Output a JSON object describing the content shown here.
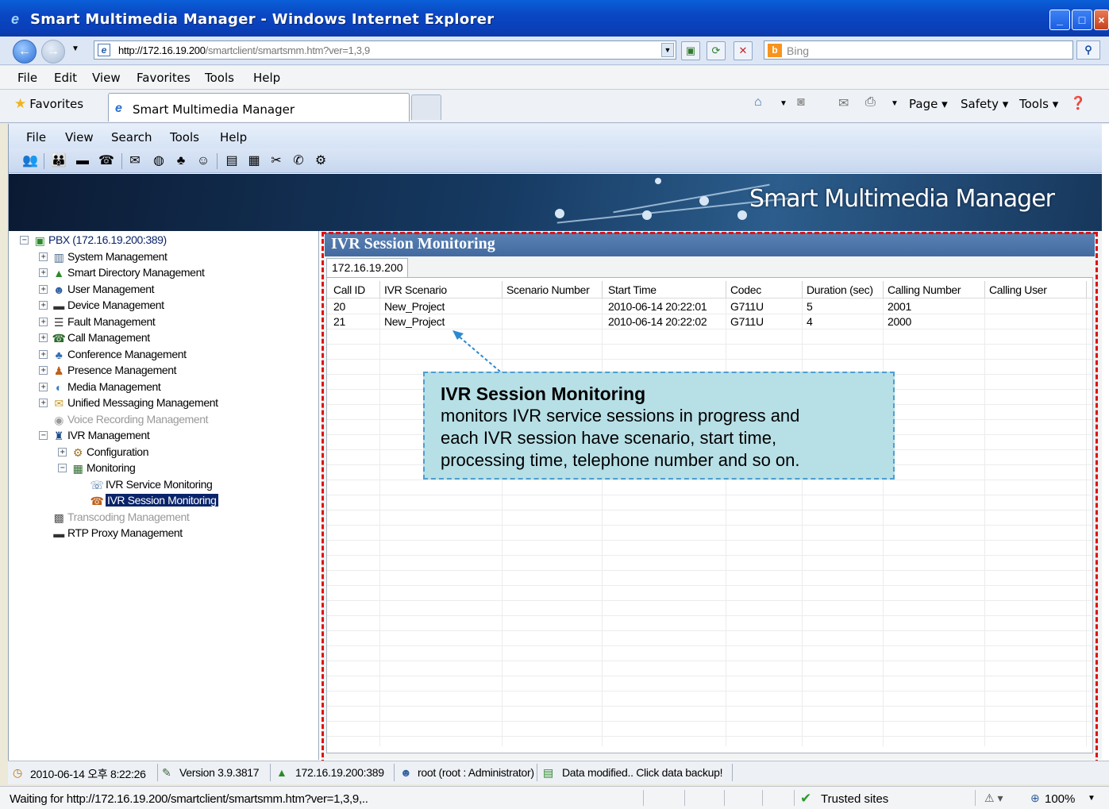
{
  "window": {
    "title": "Smart Multimedia Manager - Windows Internet Explorer"
  },
  "addressbar": {
    "url_host": "http://172.16.19.200",
    "url_path": "/smartclient/smartsmm.htm?ver=1,3,9",
    "search_placeholder": "Bing"
  },
  "ie_menu": [
    "File",
    "Edit",
    "View",
    "Favorites",
    "Tools",
    "Help"
  ],
  "favorites": {
    "label": "Favorites",
    "tab_title": "Smart Multimedia Manager",
    "commands": [
      "Page",
      "Safety",
      "Tools"
    ]
  },
  "app_menu": [
    "File",
    "View",
    "Search",
    "Tools",
    "Help"
  ],
  "banner": {
    "title": "Smart Multimedia Manager"
  },
  "tree": [
    {
      "label": "PBX (172.16.19.200:389)",
      "level": 0,
      "exp": "−",
      "icon": "pbx-icon"
    },
    {
      "label": "System Management",
      "level": 1,
      "exp": "+",
      "icon": "system-icon"
    },
    {
      "label": "Smart Directory Management",
      "level": 1,
      "exp": "+",
      "icon": "directory-icon"
    },
    {
      "label": "User Management",
      "level": 1,
      "exp": "+",
      "icon": "user-icon"
    },
    {
      "label": "Device Management",
      "level": 1,
      "exp": "+",
      "icon": "device-icon"
    },
    {
      "label": "Fault Management",
      "level": 1,
      "exp": "+",
      "icon": "fault-icon"
    },
    {
      "label": "Call Management",
      "level": 1,
      "exp": "+",
      "icon": "call-icon"
    },
    {
      "label": "Conference Management",
      "level": 1,
      "exp": "+",
      "icon": "conference-icon"
    },
    {
      "label": "Presence Management",
      "level": 1,
      "exp": "+",
      "icon": "presence-icon"
    },
    {
      "label": "Media Management",
      "level": 1,
      "exp": "+",
      "icon": "media-icon"
    },
    {
      "label": "Unified Messaging Management",
      "level": 1,
      "exp": "+",
      "icon": "messaging-icon"
    },
    {
      "label": "Voice Recording Management",
      "level": 1,
      "exp": "",
      "icon": "recording-icon",
      "dim": true
    },
    {
      "label": "IVR Management",
      "level": 1,
      "exp": "−",
      "icon": "ivr-icon"
    },
    {
      "label": "Configuration",
      "level": 2,
      "exp": "+",
      "icon": "configuration-icon"
    },
    {
      "label": "Monitoring",
      "level": 2,
      "exp": "−",
      "icon": "monitoring-icon"
    },
    {
      "label": "IVR Service Monitoring",
      "level": 3,
      "exp": "",
      "icon": "service-monitor-icon"
    },
    {
      "label": "IVR Session Monitoring",
      "level": 3,
      "exp": "",
      "icon": "session-monitor-icon",
      "selected": true
    },
    {
      "label": "Transcoding Management",
      "level": 1,
      "exp": "",
      "icon": "transcoding-icon",
      "dim": true
    },
    {
      "label": "RTP Proxy Management",
      "level": 1,
      "exp": "",
      "icon": "rtp-proxy-icon"
    }
  ],
  "panel": {
    "title": "IVR Session Monitoring",
    "server_tab": "172.16.19.200",
    "columns": [
      "Call ID",
      "IVR Scenario",
      "Scenario Number",
      "Start Time",
      "Codec",
      "Duration (sec)",
      "Calling Number",
      "Calling User"
    ],
    "rows": [
      [
        "20",
        "New_Project",
        "",
        "2010-06-14 20:22:01",
        "G711U",
        "5",
        "2001",
        ""
      ],
      [
        "21",
        "New_Project",
        "",
        "2010-06-14 20:22:02",
        "G711U",
        "4",
        "2000",
        ""
      ]
    ]
  },
  "callout": {
    "title": "IVR Session Monitoring",
    "lines": [
      "monitors IVR service sessions in progress and",
      "each IVR session have scenario, start time,",
      "processing time, telephone number and so on."
    ]
  },
  "app_status": {
    "datetime": "2010-06-14 오후 8:22:26",
    "version": "Version 3.9.3817",
    "server": "172.16.19.200:389",
    "user": "root (root : Administrator)",
    "notice": "Data modified.. Click data backup!"
  },
  "ie_status": {
    "message": "Waiting for http://172.16.19.200/smartclient/smartsmm.htm?ver=1,3,9,..",
    "zone": "Trusted sites",
    "zoom": "100%"
  },
  "colors": {
    "annotation_red": "#e01010",
    "callout_bg": "#b7dfe6",
    "selection": "#0a246a"
  }
}
